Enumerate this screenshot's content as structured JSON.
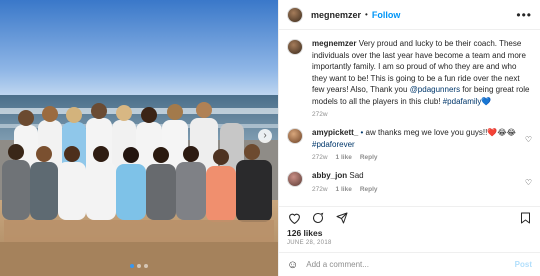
{
  "post": {
    "author": "megnemzer",
    "follow_label": "Follow",
    "separator": "•",
    "more_label": "•••",
    "caption_user": "megnemzer",
    "caption_text": "Very proud and lucky to be their coach. These individuals over the last year have become a team and more importantly family. I am so proud of who they are and who they want to be! This is going to be a fun ride over the next few years! Also, Thank you ",
    "caption_tag1": "@pdagunners",
    "caption_text2": " for being great role models to all the players in this club! ",
    "caption_tag2": "#pdafamily",
    "caption_emoji": "💙",
    "caption_age": "272w",
    "likes": "126 likes",
    "date": "JUNE 28, 2018",
    "add_comment_placeholder": "Add a comment...",
    "post_label": "Post"
  },
  "comments": [
    {
      "user": "amypickett_",
      "verified_mark": "•",
      "text": "aw thanks meg we love you guys!!",
      "emojis": "❤️😂😂",
      "tag": "#pdaforever",
      "age": "272w",
      "likes": "1 like",
      "reply": "Reply"
    },
    {
      "user": "abby_jon",
      "text": "Sad",
      "age": "272w",
      "likes": "1 like",
      "reply": "Reply"
    }
  ],
  "icons": {
    "like": "heart-icon",
    "comment": "comment-icon",
    "share": "share-icon",
    "save": "bookmark-icon",
    "emoji": "smiley-icon",
    "next": "chevron-right-icon"
  },
  "colors": {
    "link": "#0095f6",
    "hashtag": "#00376b",
    "muted": "#8e8e8e",
    "active_dot": "#3897f0"
  }
}
